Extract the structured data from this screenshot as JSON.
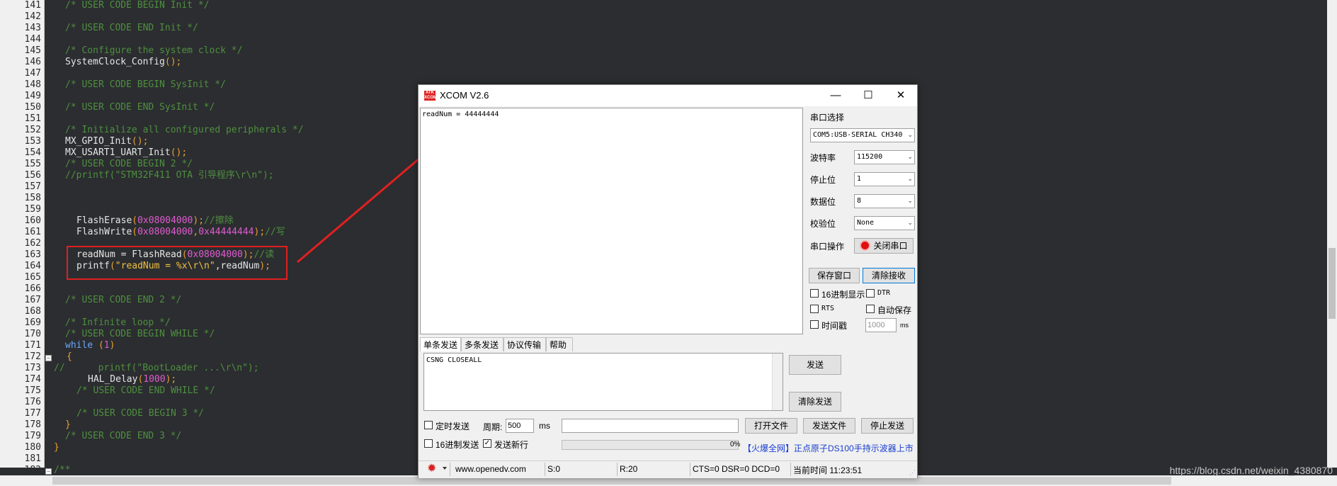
{
  "editor": {
    "gutter_lines": [
      "141",
      "142",
      "143",
      "144",
      "145",
      "146",
      "147",
      "148",
      "149",
      "150",
      "151",
      "152",
      "153",
      "154",
      "155",
      "156",
      "157",
      "158",
      "159",
      "160",
      "161",
      "162",
      "163",
      "164",
      "165",
      "166",
      "167",
      "168",
      "169",
      "170",
      "171",
      "172",
      "173",
      "174",
      "175",
      "176",
      "177",
      "178",
      "179",
      "180",
      "181",
      "182"
    ],
    "code": {
      "l141": "/* USER CODE BEGIN Init */",
      "l143": "/* USER CODE END Init */",
      "l145": "/* Configure the system clock */",
      "l146_fn": "SystemClock_Config",
      "l146_p": "();",
      "l148": "/* USER CODE BEGIN SysInit */",
      "l150": "/* USER CODE END SysInit */",
      "l152": "/* Initialize all configured peripherals */",
      "l153_fn": "MX_GPIO_Init",
      "l153_p": "();",
      "l154_fn": "MX_USART1_UART_Init",
      "l154_p": "();",
      "l155": "/* USER CODE BEGIN 2 */",
      "l156": "//printf(\"STM32F411 OTA 引导程序\\r\\n\");",
      "l160_fn": "FlashErase",
      "l160_a": "(",
      "l160_n": "0x08004000",
      "l160_b": ");",
      "l160_c": "//擦除",
      "l161_fn": "FlashWrite",
      "l161_a": "(",
      "l161_n1": "0x08004000",
      "l161_m": ",",
      "l161_n2": "0x44444444",
      "l161_b": ");",
      "l161_c": "//写",
      "l163_t": "readNum = FlashRead",
      "l163_a": "(",
      "l163_n": "0x08004000",
      "l163_b": ");",
      "l163_c": "//读",
      "l164_t": "printf",
      "l164_a": "(",
      "l164_s": "\"readNum = %x\\r\\n\"",
      "l164_m": ",readNum",
      "l164_b": ");",
      "l167": "/* USER CODE END 2 */",
      "l169": "/* Infinite loop */",
      "l170": "/* USER CODE BEGIN WHILE */",
      "l171_k": "while",
      "l171_a": " (",
      "l171_n": "1",
      "l171_b": ")",
      "l172": "{",
      "l173": "//      printf(\"BootLoader ...\\r\\n\");",
      "l174_fn": "HAL_Delay",
      "l174_a": "(",
      "l174_n": "1000",
      "l174_b": ");",
      "l175": "/* USER CODE END WHILE */",
      "l177": "/* USER CODE BEGIN 3 */",
      "l178": "}",
      "l179": "/* USER CODE END 3 */",
      "l180": "}",
      "l182": "/**"
    },
    "watermark": "https://blog.csdn.net/weixin_4380870"
  },
  "xcom": {
    "icon_text": "ATK XCOM",
    "title": "XCOM V2.6",
    "min_glyph": "—",
    "max_glyph": "☐",
    "close_glyph": "✕",
    "receive_text": "readNum = 44444444",
    "port_select_label": "串口选择",
    "port_value": "COM5:USB-SERIAL CH340",
    "baud_label": "波特率",
    "baud_value": "115200",
    "stopbits_label": "停止位",
    "stopbits_value": "1",
    "databits_label": "数据位",
    "databits_value": "8",
    "parity_label": "校验位",
    "parity_value": "None",
    "port_op_label": "串口操作",
    "close_port_button": "关闭串口",
    "save_window_button": "保存窗口",
    "clear_receive_button": "清除接收",
    "hex_display_label": "16进制显示",
    "dtr_label": "DTR",
    "rts_label": "RTS",
    "autosave_label": "自动保存",
    "timestamp_label": "时间戳",
    "timestamp_value": "1000",
    "timestamp_unit": "ms",
    "tabs": [
      "单条发送",
      "多条发送",
      "协议传输",
      "帮助"
    ],
    "send_text": "CSNG CLOSEALL",
    "send_button": "发送",
    "clear_send_button": "清除发送",
    "timed_send_label": "定时发送",
    "period_label": "周期:",
    "period_value": "500",
    "period_unit": "ms",
    "open_file_button": "打开文件",
    "send_file_button": "发送文件",
    "stop_send_button": "停止发送",
    "hex_send_label": "16进制发送",
    "send_newline_label": "发送新行",
    "progress_percent": "0%",
    "progress_value": 0,
    "ad_text": "【火爆全网】正点原子DS100手持示波器上市",
    "status": {
      "website": "www.openedv.com",
      "sent": "S:0",
      "received": "R:20",
      "lines": "CTS=0 DSR=0 DCD=0",
      "time": "当前时间 11:23:51"
    },
    "checkmark": "✓"
  }
}
